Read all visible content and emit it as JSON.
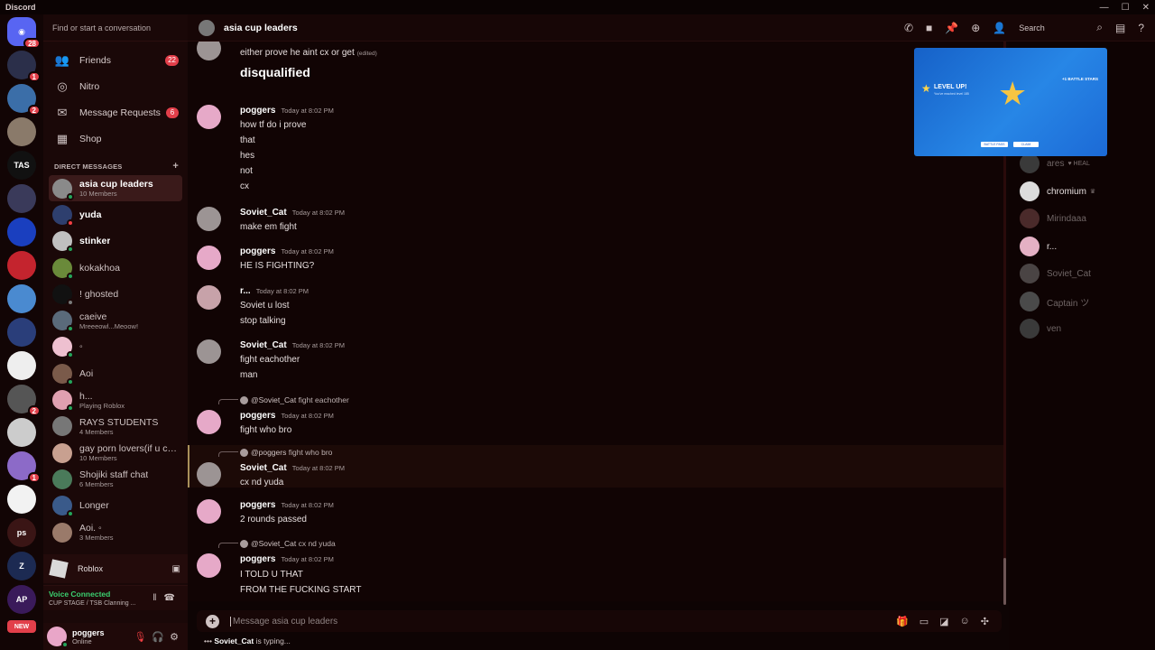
{
  "window": {
    "app_name": "Discord"
  },
  "rail": {
    "servers": [
      {
        "name": "home",
        "label": "",
        "badge": "28",
        "color": "#5865f2"
      },
      {
        "name": "server-2",
        "label": "",
        "badge": "1",
        "color": "#2b2f4a"
      },
      {
        "name": "server-3",
        "label": "",
        "badge": "2",
        "color": "#3b6ea8"
      },
      {
        "name": "server-4",
        "label": "",
        "badge": "",
        "color": "#8a7a6a"
      },
      {
        "name": "server-tas",
        "label": "TAS",
        "badge": "",
        "color": "#111111"
      },
      {
        "name": "server-6",
        "label": "",
        "badge": "",
        "color": "#3a3a5a"
      },
      {
        "name": "server-7",
        "label": "",
        "badge": "",
        "color": "#1a3fbf"
      },
      {
        "name": "server-8",
        "label": "",
        "badge": "",
        "color": "#c4242e"
      },
      {
        "name": "server-9",
        "label": "",
        "badge": "",
        "color": "#4a8ad0"
      },
      {
        "name": "server-10",
        "label": "",
        "badge": "",
        "color": "#2a3e7a"
      },
      {
        "name": "server-11",
        "label": "",
        "badge": "",
        "color": "#eeeeee"
      },
      {
        "name": "server-12",
        "label": "",
        "badge": "2",
        "color": "#555555"
      },
      {
        "name": "server-13",
        "label": "",
        "badge": "",
        "color": "#cccccc"
      },
      {
        "name": "server-14",
        "label": "",
        "badge": "1",
        "color": "#8c6ac8"
      },
      {
        "name": "server-15",
        "label": "",
        "badge": "",
        "color": "#f2f2f2"
      },
      {
        "name": "server-ps",
        "label": "ps",
        "badge": "",
        "color": "#3a1515"
      },
      {
        "name": "server-17",
        "label": "Z",
        "badge": "",
        "color": "#1c2a52"
      },
      {
        "name": "server-18",
        "label": "AP",
        "badge": "",
        "color": "#3a1a5a"
      }
    ],
    "new_label": "NEW"
  },
  "sidebar": {
    "search_placeholder": "Find or start a conversation",
    "nav": [
      {
        "label": "Friends",
        "icon": "friends-icon",
        "glyph": "👥",
        "count": "22"
      },
      {
        "label": "Nitro",
        "icon": "nitro-icon",
        "glyph": "◎",
        "count": ""
      },
      {
        "label": "Message Requests",
        "icon": "mail-icon",
        "glyph": "✉",
        "count": "6"
      },
      {
        "label": "Shop",
        "icon": "shop-icon",
        "glyph": "▦",
        "count": ""
      }
    ],
    "dm_header": "DIRECT MESSAGES",
    "dms": [
      {
        "name": "asia cup leaders",
        "sub": "10 Members",
        "active": true,
        "bold": true,
        "status": "online",
        "color": "#8a8a8a"
      },
      {
        "name": "yuda",
        "sub": "",
        "active": false,
        "bold": true,
        "status": "dnd",
        "color": "#2e3f6e"
      },
      {
        "name": "stinker",
        "sub": "",
        "active": false,
        "bold": true,
        "status": "online",
        "color": "#c0c0c0"
      },
      {
        "name": "kokakhoa",
        "sub": "",
        "active": false,
        "bold": false,
        "status": "online",
        "color": "#6a8a3a"
      },
      {
        "name": "! ghosted",
        "sub": "",
        "active": false,
        "bold": false,
        "status": "idle",
        "color": "#111111"
      },
      {
        "name": "caeive",
        "sub": "Mreeeowl...Meoow!",
        "active": false,
        "bold": false,
        "status": "online",
        "color": "#5a6a7a"
      },
      {
        "name": "◦",
        "sub": "",
        "active": false,
        "bold": false,
        "status": "online",
        "color": "#eec0d0"
      },
      {
        "name": "Aoi",
        "sub": "",
        "active": false,
        "bold": false,
        "status": "online",
        "color": "#7a5a4a"
      },
      {
        "name": "h...",
        "sub": "Playing Roblox",
        "active": false,
        "bold": false,
        "status": "online",
        "color": "#e0a0b0"
      },
      {
        "name": "RAYS STUDENTS",
        "sub": "4 Members",
        "active": false,
        "bold": false,
        "status": "",
        "color": "#777777"
      },
      {
        "name": "gay porn lovers(if u ch...",
        "sub": "10 Members",
        "active": false,
        "bold": false,
        "status": "",
        "color": "#c8a090"
      },
      {
        "name": "Shojiki staff chat",
        "sub": "6 Members",
        "active": false,
        "bold": false,
        "status": "",
        "color": "#4a7a5a"
      },
      {
        "name": "Longer",
        "sub": "",
        "active": false,
        "bold": false,
        "status": "online",
        "color": "#3a5a8a"
      },
      {
        "name": "Aoi. ◦",
        "sub": "3 Members",
        "active": false,
        "bold": false,
        "status": "",
        "color": "#9a7a6a"
      }
    ],
    "activity": {
      "label": "Roblox"
    },
    "voice": {
      "status": "Voice Connected",
      "channel": "CUP STAGE / TSB Clanning ..."
    },
    "user": {
      "name": "poggers",
      "status": "Online"
    }
  },
  "chat": {
    "title": "asia cup leaders",
    "search_label": "Search",
    "composer_placeholder": "Message asia cup leaders",
    "typing_user": "Soviet_Cat",
    "typing_suffix": "is typing...",
    "messages": [
      {
        "author": "",
        "time": "",
        "avatar": "soviet",
        "lines": [
          "either prove he aint cx or get",
          "disqualified"
        ],
        "edited": "(edited)"
      },
      {
        "author": "poggers",
        "time": "Today at 8:02 PM",
        "avatar": "poggers",
        "lines": [
          "how tf do i prove",
          "that",
          "hes",
          "not",
          "cx"
        ]
      },
      {
        "author": "Soviet_Cat",
        "time": "Today at 8:02 PM",
        "avatar": "soviet",
        "lines": [
          "make em fight"
        ]
      },
      {
        "author": "poggers",
        "time": "Today at 8:02 PM",
        "avatar": "poggers",
        "lines": [
          "HE IS FIGHTING?"
        ]
      },
      {
        "author": "r...",
        "time": "Today at 8:02 PM",
        "avatar": "rdot",
        "lines": [
          "Soviet u lost",
          "stop talking"
        ]
      },
      {
        "author": "Soviet_Cat",
        "time": "Today at 8:02 PM",
        "avatar": "soviet",
        "lines": [
          "fight eachother",
          "man"
        ]
      },
      {
        "author": "poggers",
        "time": "Today at 8:02 PM",
        "avatar": "poggers",
        "reply_to": "@Soviet_Cat",
        "reply_text": "fight eachother",
        "lines": [
          "fight who bro"
        ]
      },
      {
        "author": "Soviet_Cat",
        "time": "Today at 8:02 PM",
        "avatar": "soviet",
        "reply_to": "@poggers",
        "reply_text": "fight who bro",
        "lines": [
          "cx nd yuda"
        ]
      },
      {
        "author": "poggers",
        "time": "Today at 8:02 PM",
        "avatar": "poggers",
        "lines": [
          "2 rounds passed"
        ]
      },
      {
        "author": "poggers",
        "time": "Today at 8:02 PM",
        "avatar": "poggers",
        "reply_to": "@Soviet_Cat",
        "reply_text": "cx nd yuda",
        "lines": [
          "I TOLD U THAT",
          "FROM THE FUCKING START"
        ]
      }
    ]
  },
  "members": [
    {
      "name": "ares",
      "tag": "♥ HEAL",
      "online": false
    },
    {
      "name": "chromium",
      "tag": "♛",
      "online": true
    },
    {
      "name": "Mirindaaa",
      "tag": "",
      "online": false
    },
    {
      "name": "r...",
      "tag": "",
      "online": true
    },
    {
      "name": "Soviet_Cat",
      "tag": "",
      "online": false
    },
    {
      "name": "Captain ツ",
      "tag": "",
      "online": false
    },
    {
      "name": "ven",
      "tag": "",
      "online": false
    }
  ],
  "overlay": {
    "title": "LEVEL UP!",
    "subtitle": "You've reached level 185",
    "reward": "+1 BATTLE STARS",
    "btn1": "BATTLE PASS",
    "btn2": "CLAIM"
  }
}
